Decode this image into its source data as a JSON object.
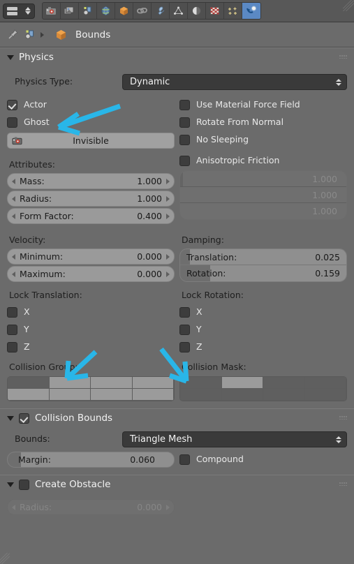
{
  "window": {
    "editor_type_icon": "properties-editor-icon",
    "tabs": [
      {
        "name": "render-tab",
        "icon": "camera-icon",
        "active": false
      },
      {
        "name": "render-layers-tab",
        "icon": "images-icon",
        "active": false
      },
      {
        "name": "scene-tab",
        "icon": "scene-icon",
        "active": false
      },
      {
        "name": "world-tab",
        "icon": "globe-icon",
        "active": false
      },
      {
        "name": "object-tab",
        "icon": "cube-icon",
        "active": false
      },
      {
        "name": "constraints-tab",
        "icon": "chain-icon",
        "active": false
      },
      {
        "name": "modifiers-tab",
        "icon": "wrench-icon",
        "active": false
      },
      {
        "name": "object-data-tab",
        "icon": "triangle-mesh-icon",
        "active": false
      },
      {
        "name": "material-tab",
        "icon": "sphere-icon",
        "active": false
      },
      {
        "name": "texture-tab",
        "icon": "checker-icon",
        "active": false
      },
      {
        "name": "particles-tab",
        "icon": "particles-icon",
        "active": false
      },
      {
        "name": "physics-tab",
        "icon": "physics-icon",
        "active": true
      }
    ]
  },
  "breadcrumb": {
    "pin_icon": "pin-icon",
    "scene_icon": "scene-icon",
    "separator": "chevron-right-icon",
    "object_icon": "cube-icon",
    "object_name": "Bounds"
  },
  "physics_panel": {
    "title": "Physics",
    "expanded": true,
    "physics_type_label": "Physics Type:",
    "physics_type_value": "Dynamic",
    "checkboxes_left": [
      {
        "label": "Actor",
        "checked": true
      },
      {
        "label": "Ghost",
        "checked": false
      }
    ],
    "invisible_button": {
      "label": "Invisible",
      "icon": "render-camera-icon"
    },
    "checkboxes_right": [
      {
        "label": "Use Material Force Field",
        "checked": false
      },
      {
        "label": "Rotate From Normal",
        "checked": false
      },
      {
        "label": "No Sleeping",
        "checked": false
      }
    ],
    "attributes_label": "Attributes:",
    "attributes": [
      {
        "label": "Mass:",
        "value": "1.000"
      },
      {
        "label": "Radius:",
        "value": "1.000"
      },
      {
        "label": "Form Factor:",
        "value": "0.400"
      }
    ],
    "anisotropic_friction": {
      "label": "Anisotropic Friction",
      "checked": false
    },
    "anisotropic_values": [
      "1.000",
      "1.000",
      "1.000"
    ],
    "velocity_label": "Velocity:",
    "velocity": [
      {
        "label": "Minimum:",
        "value": "0.000"
      },
      {
        "label": "Maximum:",
        "value": "0.000"
      }
    ],
    "damping_label": "Damping:",
    "damping": [
      {
        "label": "Translation:",
        "value": "0.025",
        "fill_pct": 3
      },
      {
        "label": "Rotation:",
        "value": "0.159",
        "fill_pct": 16
      }
    ],
    "lock_translation_label": "Lock Translation:",
    "lock_translation": [
      {
        "label": "X",
        "checked": false
      },
      {
        "label": "Y",
        "checked": false
      },
      {
        "label": "Z",
        "checked": false
      }
    ],
    "lock_rotation_label": "Lock Rotation:",
    "lock_rotation": [
      {
        "label": "X",
        "checked": false
      },
      {
        "label": "Y",
        "checked": false
      },
      {
        "label": "Z",
        "checked": false
      }
    ],
    "collision_group_label": "Collision Group:",
    "collision_group_cells": [
      [
        false,
        true,
        true,
        true
      ],
      [
        true,
        true,
        true,
        true
      ]
    ],
    "collision_mask_label": "Collision Mask:",
    "collision_mask_cells": [
      [
        false,
        true,
        false,
        false
      ],
      [
        false,
        false,
        false,
        false
      ]
    ]
  },
  "collision_bounds_panel": {
    "title": "Collision Bounds",
    "enabled": true,
    "expanded": true,
    "bounds_label": "Bounds:",
    "bounds_value": "Triangle Mesh",
    "margin": {
      "label": "Margin:",
      "value": "0.060",
      "fill_pct": 7
    },
    "compound": {
      "label": "Compound",
      "checked": false
    }
  },
  "create_obstacle_panel": {
    "title": "Create Obstacle",
    "enabled": false,
    "expanded": true,
    "radius": {
      "label": "Radius:",
      "value": "0.000",
      "disabled": true
    }
  },
  "annotations": {
    "arrow_color": "#29b6e8",
    "arrows": [
      {
        "name": "arrow-to-ghost",
        "points_to": "Ghost"
      },
      {
        "name": "arrow-to-collision-group",
        "points_to": "Collision Group:"
      },
      {
        "name": "arrow-to-collision-mask",
        "points_to": "Collision Mask:"
      }
    ]
  }
}
